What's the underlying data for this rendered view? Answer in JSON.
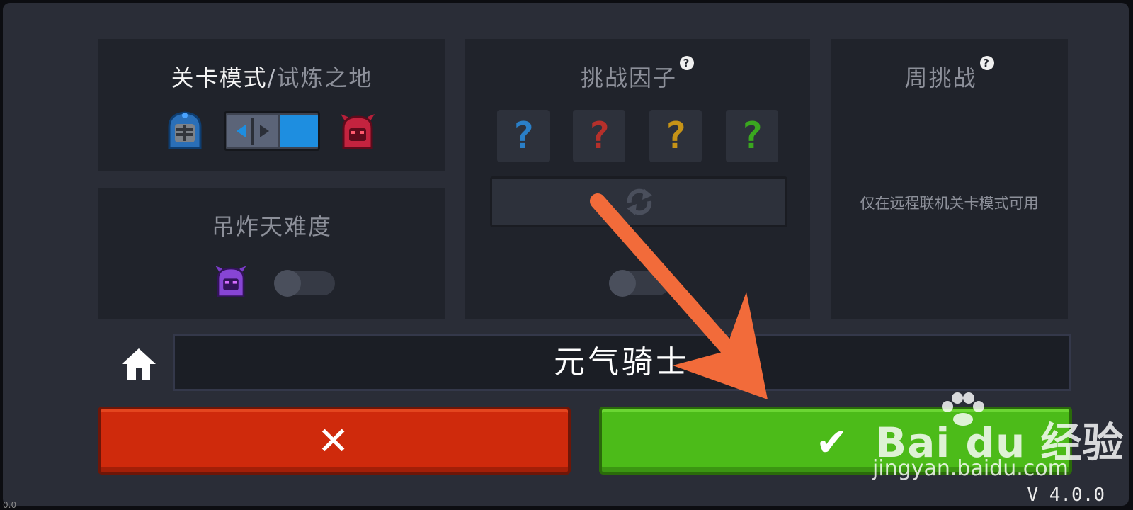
{
  "level_panel": {
    "mode_label": "关卡模式",
    "separator": "/",
    "trial_label": "试炼之地",
    "switch_icons": [
      "knight-helmet-icon",
      "demon-helmet-icon"
    ],
    "toggle_state": "right"
  },
  "difficulty_panel": {
    "title": "吊炸天难度",
    "enabled": false
  },
  "challenge_panel": {
    "title": "挑战因子",
    "help_glyph": "?",
    "factor_slots": [
      {
        "glyph": "?",
        "color": "#2a7fc7"
      },
      {
        "glyph": "?",
        "color": "#b5302b"
      },
      {
        "glyph": "?",
        "color": "#c69317"
      },
      {
        "glyph": "?",
        "color": "#3aa71f"
      }
    ],
    "reroll_icon": "refresh-icon",
    "enabled": false
  },
  "weekly_panel": {
    "title": "周挑战",
    "help_glyph": "?",
    "notice": "仅在远程联机关卡模式可用"
  },
  "name_bar": {
    "home_icon": "home-icon",
    "name": "元气骑士"
  },
  "buttons": {
    "cancel_glyph": "✕",
    "confirm_glyph": "✔"
  },
  "version": "V 4.0.0",
  "corner_text": "0.0",
  "watermark": {
    "brand": "Bai du 经验",
    "url": "jingyan.baidu.com"
  },
  "colors": {
    "cancel": "#cf2a0c",
    "confirm": "#4cbb19",
    "arrow": "#f26b3a",
    "toggle_blue": "#1e8ee0"
  }
}
